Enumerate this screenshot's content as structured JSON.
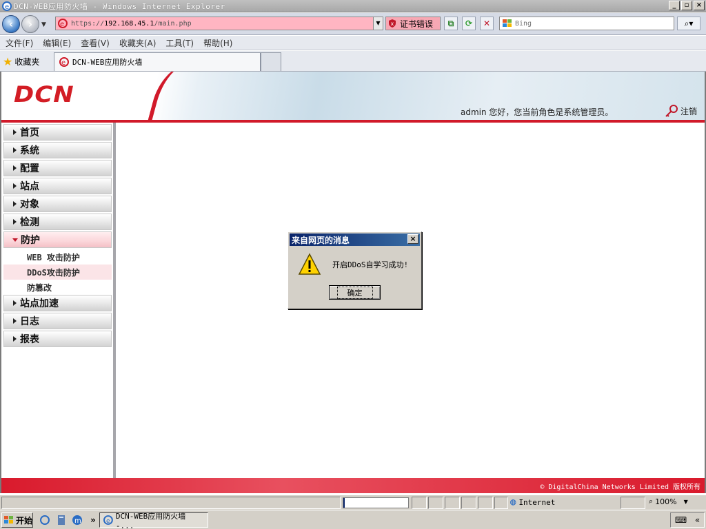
{
  "window": {
    "title": "DCN-WEB应用防火墙 - Windows Internet Explorer"
  },
  "address": {
    "url_prefix": "https://",
    "url_host": "192.168.45.1",
    "url_path": "/main.php",
    "cert_error": "证书错误"
  },
  "search": {
    "placeholder": "Bing"
  },
  "menu": [
    "文件(F)",
    "编辑(E)",
    "查看(V)",
    "收藏夹(A)",
    "工具(T)",
    "帮助(H)"
  ],
  "favorites": {
    "label": "收藏夹"
  },
  "tab": {
    "label": "DCN-WEB应用防火墙"
  },
  "header": {
    "logo": "DCN",
    "user": "admin",
    "greeting": " 您好，您当前角色是系统管理员。",
    "logout": "注销"
  },
  "sidebar": {
    "items": [
      {
        "label": "首页"
      },
      {
        "label": "系统"
      },
      {
        "label": "配置"
      },
      {
        "label": "站点"
      },
      {
        "label": "对象"
      },
      {
        "label": "检测"
      },
      {
        "label": "防护",
        "open": true
      },
      {
        "label": "站点加速"
      },
      {
        "label": "日志"
      },
      {
        "label": "报表"
      }
    ],
    "subitems": [
      {
        "label": "WEB 攻击防护"
      },
      {
        "label": "DDoS攻击防护",
        "active": true
      },
      {
        "label": "防篡改"
      }
    ]
  },
  "footer": {
    "copyright": "© DigitalChina Networks Limited 版权所有"
  },
  "dialog": {
    "title": "来自网页的消息",
    "message": "开启DDoS自学习成功!",
    "ok": "确定"
  },
  "status": {
    "zone": "Internet",
    "zoom": "100%"
  },
  "taskbar": {
    "start": "开始",
    "more": "»",
    "task": "DCN-WEB应用防火墙 -..."
  },
  "colors": {
    "brand_red": "#d11a2a",
    "dialog_title": "#0a246a",
    "address_error": "#ffb5c2"
  }
}
